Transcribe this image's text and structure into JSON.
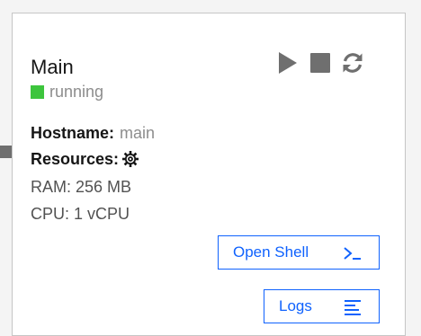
{
  "card": {
    "title": "Main",
    "status": {
      "label": "running",
      "color": "#3dc53d"
    },
    "controls": {
      "icons": [
        "play-icon",
        "stop-icon",
        "restart-icon"
      ]
    },
    "hostname": {
      "label": "Hostname:",
      "value": "main"
    },
    "resources": {
      "label": "Resources:",
      "icon": "gear-icon"
    },
    "ram": "RAM: 256 MB",
    "cpu": "CPU: 1 vCPU",
    "buttons": {
      "open_shell": "Open Shell",
      "logs": "Logs"
    }
  },
  "colors": {
    "accent": "#0f62fe",
    "control_gray": "#6f6f6f"
  }
}
